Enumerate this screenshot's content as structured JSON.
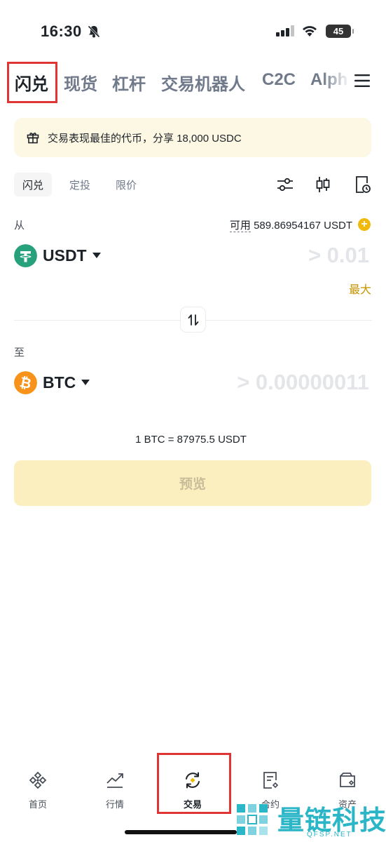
{
  "status_bar": {
    "time": "16:30",
    "battery": "45"
  },
  "top_nav": {
    "tabs": [
      {
        "label": "闪兑",
        "active": true
      },
      {
        "label": "现货",
        "active": false
      },
      {
        "label": "杠杆",
        "active": false
      },
      {
        "label": "交易机器人",
        "active": false
      },
      {
        "label": "C2C",
        "active": false
      },
      {
        "label": "Alph",
        "active": false
      }
    ],
    "menu_icon": "hamburger-menu-icon"
  },
  "promo": {
    "icon": "gift-icon",
    "text": "交易表现最佳的代币，分享 18,000 USDC"
  },
  "sub_tabs": {
    "tabs": [
      {
        "label": "闪兑",
        "active": true
      },
      {
        "label": "定投",
        "active": false
      },
      {
        "label": "限价",
        "active": false
      }
    ],
    "tools": [
      "sliders-icon",
      "candlestick-icon",
      "order-history-icon"
    ]
  },
  "from": {
    "label": "从",
    "available_label": "可用",
    "available_value": "589.86954167 USDT",
    "coin": "USDT",
    "coin_icon": "tether-icon",
    "amount_placeholder": "> 0.01",
    "max_label": "最大"
  },
  "to": {
    "label": "至",
    "coin": "BTC",
    "coin_icon": "bitcoin-icon",
    "amount_placeholder": "> 0.00000011"
  },
  "rate": "1 BTC = 87975.5 USDT",
  "preview_button": "预览",
  "bottom_nav": [
    {
      "label": "首页",
      "icon": "binance-home-icon",
      "active": false
    },
    {
      "label": "行情",
      "icon": "market-chart-icon",
      "active": false
    },
    {
      "label": "交易",
      "icon": "trade-swap-icon",
      "active": true
    },
    {
      "label": "合约",
      "icon": "futures-doc-icon",
      "active": false
    },
    {
      "label": "资产",
      "icon": "wallet-icon",
      "active": false
    }
  ],
  "watermark": {
    "text": "量链科技",
    "subtext": "QFSP.NET"
  },
  "colors": {
    "accent": "#f0b90b",
    "max_link": "#c99400",
    "preview_bg": "#fcefbf",
    "promo_bg": "#fdf8e4",
    "highlight": "#e03535",
    "usdt": "#26a17b",
    "btc": "#f7931a"
  }
}
